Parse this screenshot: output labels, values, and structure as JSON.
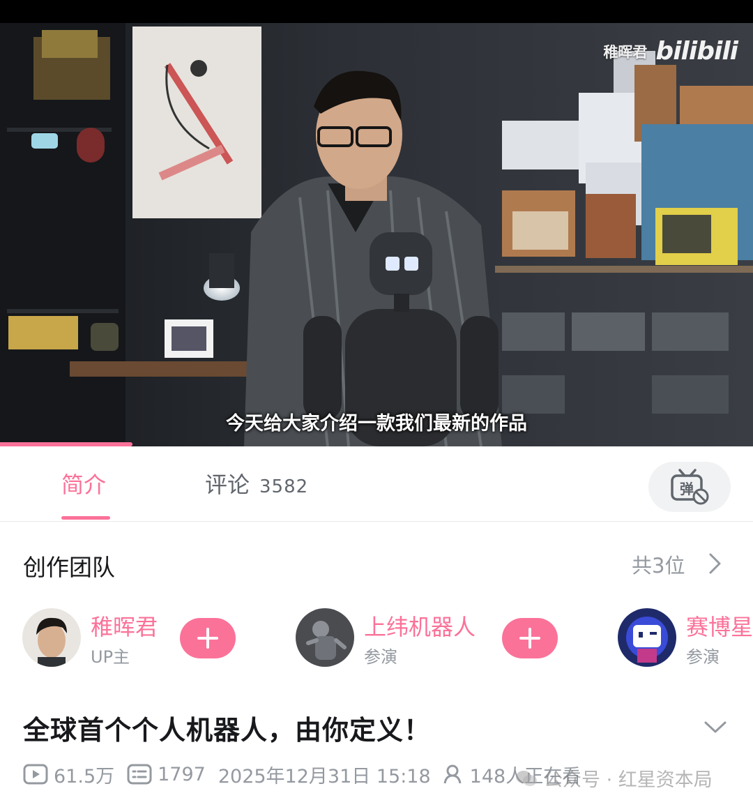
{
  "player": {
    "watermark_author": "稚晖君",
    "watermark_logo": "bilibili",
    "subtitle": "今天给大家介绍一款我们最新的作品",
    "progress": 0.176
  },
  "tabs": {
    "intro_label": "简介",
    "comments_label": "评论",
    "comments_count": "3582",
    "danmaku_glyph": "弹"
  },
  "team": {
    "title": "创作团队",
    "count_label": "共3位",
    "members": [
      {
        "name": "稚晖君",
        "role": "UP主"
      },
      {
        "name": "上纬机器人",
        "role": "参演"
      },
      {
        "name": "赛博星",
        "role": "参演"
      }
    ]
  },
  "video": {
    "title": "全球首个个人机器人，由你定义！",
    "views": "61.5万",
    "danmaku_count": "1797",
    "date": "2025年12月31日 15:18",
    "watching": "148人正在看"
  },
  "footer_watermark": "公众号 · 红星资本局",
  "colors": {
    "accent": "#fb7299",
    "muted_text": "#9499a0",
    "tab_text": "#61666d"
  }
}
